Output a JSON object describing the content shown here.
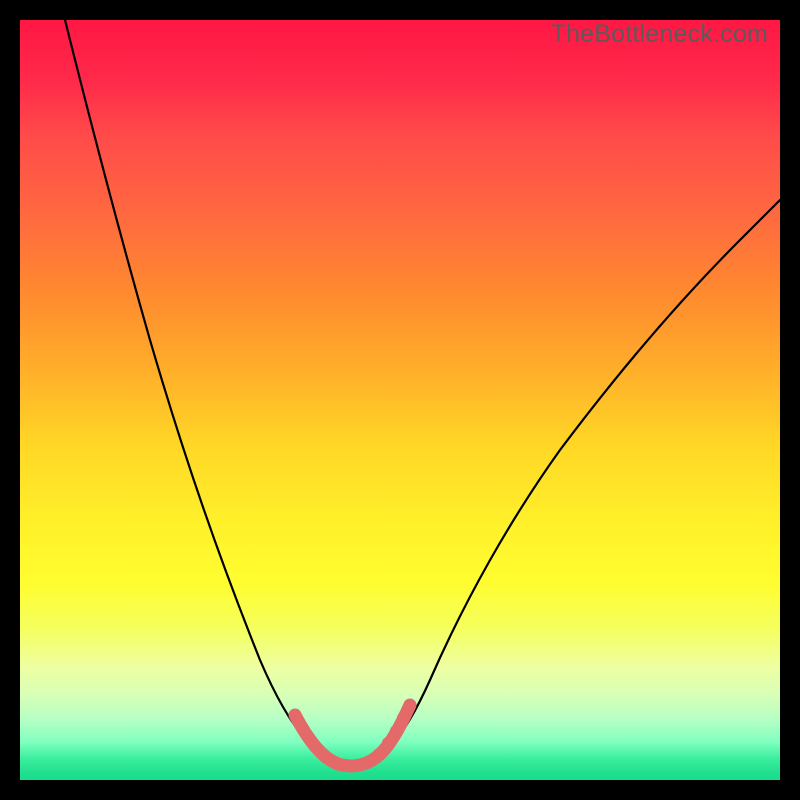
{
  "watermark": "TheBottleneck.com",
  "colors": {
    "background": "#000000",
    "gradient_top": "#ff1744",
    "gradient_mid": "#ffd726",
    "gradient_bottom": "#19dd8c",
    "curve_stroke": "#000000",
    "marker_stroke": "#e46a6a"
  },
  "chart_data": {
    "type": "line",
    "title": "",
    "xlabel": "",
    "ylabel": "",
    "xlim": [
      0,
      100
    ],
    "ylim": [
      0,
      100
    ],
    "series": [
      {
        "name": "bottleneck-curve",
        "x": [
          6,
          8,
          10,
          12,
          14,
          16,
          18,
          20,
          22,
          24,
          26,
          28,
          30,
          32,
          34,
          36,
          38,
          40,
          42,
          44,
          46,
          48,
          50,
          54,
          58,
          62,
          66,
          70,
          74,
          78,
          82,
          86,
          90,
          94,
          98,
          100
        ],
        "values": [
          100,
          92,
          84,
          77,
          70,
          63,
          56,
          50,
          44,
          38,
          33,
          28,
          23,
          19,
          15,
          11,
          8,
          5,
          3,
          2,
          2,
          3,
          5,
          9,
          14,
          19,
          24,
          29,
          34,
          39,
          44,
          48,
          53,
          57,
          61,
          63
        ]
      }
    ],
    "annotations": [],
    "marker_region_x": [
      36,
      50
    ],
    "notes": "No axes, ticks, or labels are rendered in the original image. The y-axis is interpreted as bottleneck percentage (0 at bottom / green, 100 at top / red). The pink segment highlights the near-minimum region of the curve."
  }
}
